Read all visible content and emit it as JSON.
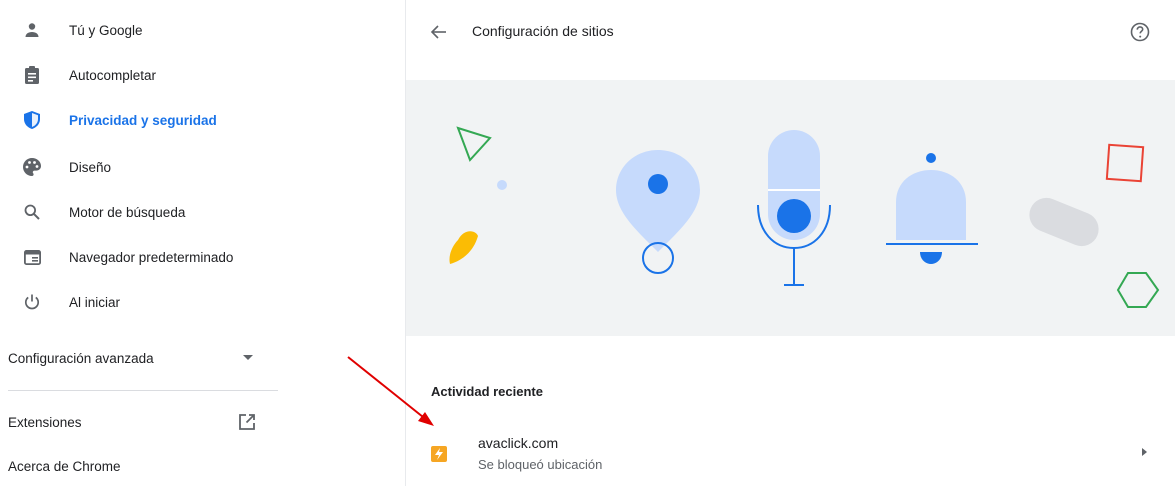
{
  "sidebar": {
    "items": [
      {
        "label": "Tú y Google",
        "icon": "person-icon"
      },
      {
        "label": "Autocompletar",
        "icon": "clipboard-icon"
      },
      {
        "label": "Privacidad y seguridad",
        "icon": "shield-icon",
        "active": true
      },
      {
        "label": "Diseño",
        "icon": "palette-icon"
      },
      {
        "label": "Motor de búsqueda",
        "icon": "search-icon"
      },
      {
        "label": "Navegador predeterminado",
        "icon": "browser-window-icon"
      },
      {
        "label": "Al iniciar",
        "icon": "power-icon"
      }
    ],
    "advanced_label": "Configuración avanzada",
    "extensions_label": "Extensiones",
    "about_label": "Acerca de Chrome"
  },
  "main": {
    "title": "Configuración de sitios",
    "recent_activity_title": "Actividad reciente",
    "recent": [
      {
        "site": "avaclick.com",
        "status": "Se bloqueó ubicación"
      }
    ]
  },
  "colors": {
    "accent": "#1a73e8",
    "hero_bg": "#f1f3f4",
    "annotation_arrow": "#e00000",
    "favicon": "#f6a623"
  }
}
